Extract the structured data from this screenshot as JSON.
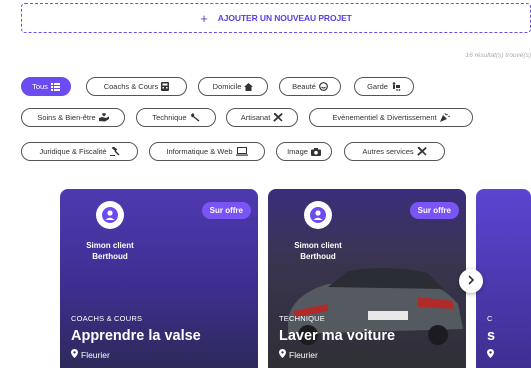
{
  "add_project": {
    "label": "AJOUTER UN NOUVEAU PROJET"
  },
  "results": {
    "text": "16 résultat(s) trouvé(s)"
  },
  "categories": [
    {
      "label": "Tous",
      "icon": "grid-icon",
      "active": true
    },
    {
      "label": "Coachs & Cours",
      "icon": "calculator-icon"
    },
    {
      "label": "Domicile",
      "icon": "home-icon"
    },
    {
      "label": "Beauté",
      "icon": "face-icon"
    },
    {
      "label": "Garde",
      "icon": "stroller-icon"
    },
    {
      "label": "Soins & Bien-être",
      "icon": "hand-heart-icon"
    },
    {
      "label": "Technique",
      "icon": "wrench-icon"
    },
    {
      "label": "Artisanat",
      "icon": "tools-icon"
    },
    {
      "label": "Evènementiel & Divertissement",
      "icon": "party-icon"
    },
    {
      "label": "Juridique & Fiscalité",
      "icon": "gavel-icon"
    },
    {
      "label": "Informatique & Web",
      "icon": "laptop-icon"
    },
    {
      "label": "Image",
      "icon": "camera-icon"
    },
    {
      "label": "Autres services",
      "icon": "tools-icon"
    }
  ],
  "cards": [
    {
      "badge": "Sur offre",
      "client_line1": "Simon client",
      "client_line2": "Berthoud",
      "category": "COACHS & COURS",
      "title": "Apprendre la valse",
      "location": "Fleurier"
    },
    {
      "badge": "Sur offre",
      "client_line1": "Simon client",
      "client_line2": "Berthoud",
      "category": "TECHNIQUE",
      "title": "Laver ma voiture",
      "location": "Fleurier"
    },
    {
      "category": "C",
      "title": "s"
    }
  ],
  "colors": {
    "accent": "#6c4cf1",
    "badge": "#7a55f5"
  }
}
